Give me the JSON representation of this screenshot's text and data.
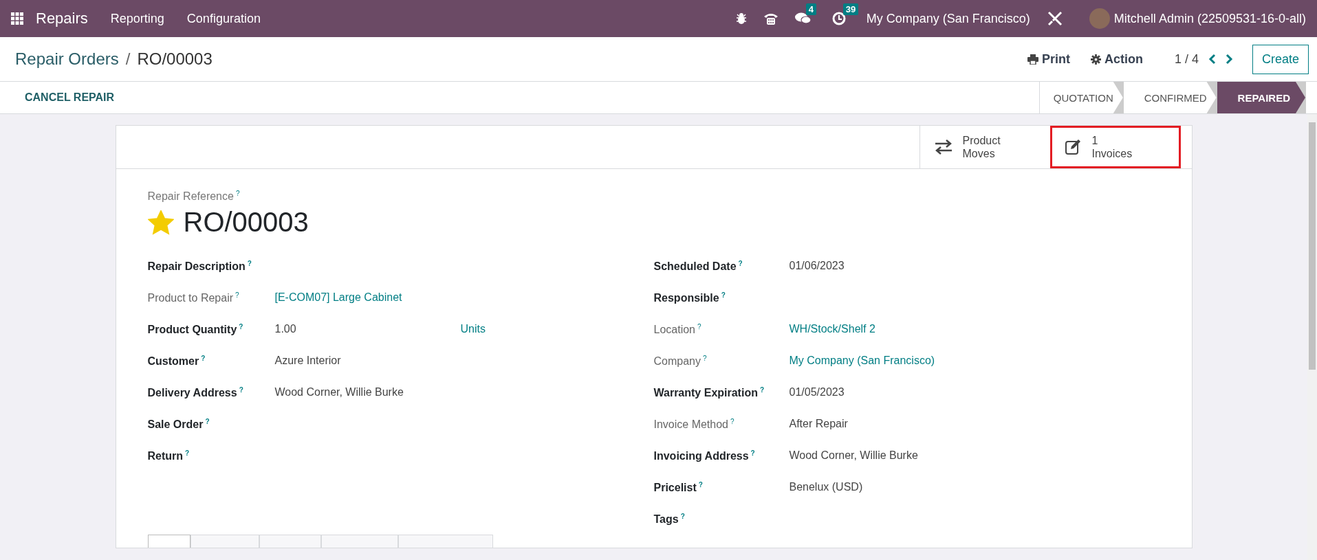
{
  "navbar": {
    "app": "Repairs",
    "menus": [
      "Reporting",
      "Configuration"
    ],
    "messages_badge": "4",
    "activities_badge": "39",
    "company": "My Company (San Francisco)",
    "user": "Mitchell Admin (22509531-16-0-all)"
  },
  "breadcrumb": {
    "parent": "Repair Orders",
    "separator": "/",
    "current": "RO/00003"
  },
  "actions": {
    "print": "Print",
    "action": "Action",
    "pager": "1 / 4",
    "create": "Create"
  },
  "status_button": "CANCEL REPAIR",
  "stages": [
    {
      "label": "QUOTATION",
      "selected": false
    },
    {
      "label": "CONFIRMED",
      "selected": false
    },
    {
      "label": "REPAIRED",
      "selected": true
    }
  ],
  "smart_buttons": [
    {
      "kind": "moves",
      "line1": "Product",
      "line2": "Moves",
      "highlighted": false
    },
    {
      "kind": "invoices",
      "line1": "1",
      "line2": "Invoices",
      "highlighted": true
    }
  ],
  "reference": {
    "label": "Repair Reference",
    "help": "?",
    "starred": true,
    "value": "RO/00003"
  },
  "left_fields": [
    {
      "label": "Repair Description",
      "help": "?",
      "emphasized": true
    },
    {
      "label": "Product to Repair",
      "help": "?",
      "emphasized": false,
      "value": "[E-COM07] Large Cabinet",
      "link": true
    },
    {
      "label": "Product Quantity",
      "help": "?",
      "emphasized": true,
      "value": "1.00",
      "link": false,
      "unit": "Units"
    },
    {
      "label": "Customer",
      "help": "?",
      "emphasized": true,
      "value": "Azure Interior",
      "link": false
    },
    {
      "label": "Delivery Address",
      "help": "?",
      "emphasized": true,
      "value": "Wood Corner, Willie Burke",
      "link": false
    },
    {
      "label": "Sale Order",
      "help": "?",
      "emphasized": true
    },
    {
      "label": "Return",
      "help": "?",
      "emphasized": true
    }
  ],
  "right_fields": [
    {
      "label": "Scheduled Date",
      "help": "?",
      "emphasized": true,
      "value": "01/06/2023",
      "link": false
    },
    {
      "label": "Responsible",
      "help": "?",
      "emphasized": true
    },
    {
      "label": "Location",
      "help": "?",
      "emphasized": false,
      "value": "WH/Stock/Shelf 2",
      "link": true
    },
    {
      "label": "Company",
      "help": "?",
      "emphasized": false,
      "value": "My Company (San Francisco)",
      "link": true
    },
    {
      "label": "Warranty Expiration",
      "help": "?",
      "emphasized": true,
      "value": "01/05/2023",
      "link": false
    },
    {
      "label": "Invoice Method",
      "help": "?",
      "emphasized": false,
      "value": "After Repair",
      "link": false
    },
    {
      "label": "Invoicing Address",
      "help": "?",
      "emphasized": true,
      "value": "Wood Corner, Willie Burke",
      "link": false
    },
    {
      "label": "Pricelist",
      "help": "?",
      "emphasized": true,
      "value": "Benelux (USD)",
      "link": false
    },
    {
      "label": "Tags",
      "help": "?",
      "emphasized": true
    }
  ],
  "notebook_tabs": [
    {
      "selected": true
    },
    {
      "selected": false
    },
    {
      "selected": false
    },
    {
      "selected": false
    },
    {
      "selected": false
    }
  ]
}
